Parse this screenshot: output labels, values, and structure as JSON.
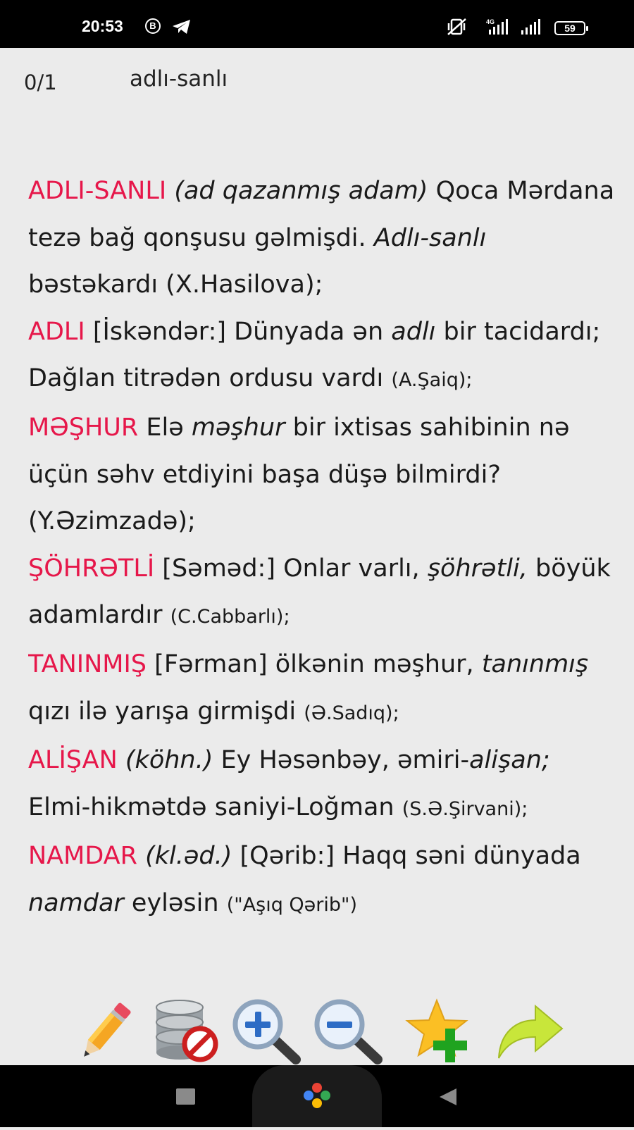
{
  "status_bar": {
    "time": "20:53",
    "b_badge": "B",
    "network": "4G",
    "battery": "59",
    "icons": [
      "telegram-icon",
      "mute-vibrate-icon",
      "signal-icon",
      "signal-icon",
      "battery-icon"
    ]
  },
  "header": {
    "counter": "0/1",
    "word": "adlı-sanlı"
  },
  "entries": [
    {
      "head": "ADLI-SANLI",
      "note": "(ad qazanmış adam)",
      "text1": "Qoca Mərdana tezə bağ qonşusu gəlmişdi.",
      "em": "Adlı-sanlı",
      "text2": "bəstəkardı (X.Hasilova);"
    },
    {
      "head": "ADLI",
      "text1": "[İskəndər:] Dünyada ən",
      "em": "adlı",
      "text2": "bir tacidardı; Dağlan titrədən ordusu vardı",
      "source": "(A.Şaiq);"
    },
    {
      "head": "MƏŞHUR",
      "text1": "Elə",
      "em": "məşhur",
      "text2": "bir ixtisas sahibinin nə üçün səhv etdiyini başa düşə bilmirdi? (Y.Əzimzadə);"
    },
    {
      "head": "ŞÖHRƏTLİ",
      "text1": "[Səməd:] Onlar varlı,",
      "em": "şöhrətli,",
      "text2": "böyük adamlardır",
      "source": "(C.Cabbarlı);"
    },
    {
      "head": "TANINMIŞ",
      "text1": "[Fərman] ölkənin məşhur,",
      "em": "tanınmış",
      "text2": "qızı ilə yarışa girmişdi",
      "source": "(Ə.Sadıq);"
    },
    {
      "head": "ALİŞAN",
      "note": "(köhn.)",
      "text1": "Ey Həsənbəy, əmiri-",
      "em": "alişan;",
      "text2": "Elmi-hikmətdə saniyi-Loğman",
      "source": "(S.Ə.Şirvani);"
    },
    {
      "head": "NAMDAR",
      "note": "(kl.əd.)",
      "text1": "[Qərib:] Haqq səni dünyada",
      "em": "namdar",
      "text2": "eyləsin",
      "source": "(\"Aşıq Qərib\")"
    }
  ],
  "toolbar": {
    "buttons": [
      "edit-pencil-icon",
      "database-delete-icon",
      "zoom-in-icon",
      "zoom-out-icon",
      "add-favorite-icon",
      "forward-arrow-icon"
    ]
  },
  "colors": {
    "headword": "#e6174a",
    "background": "#ebebeb"
  }
}
